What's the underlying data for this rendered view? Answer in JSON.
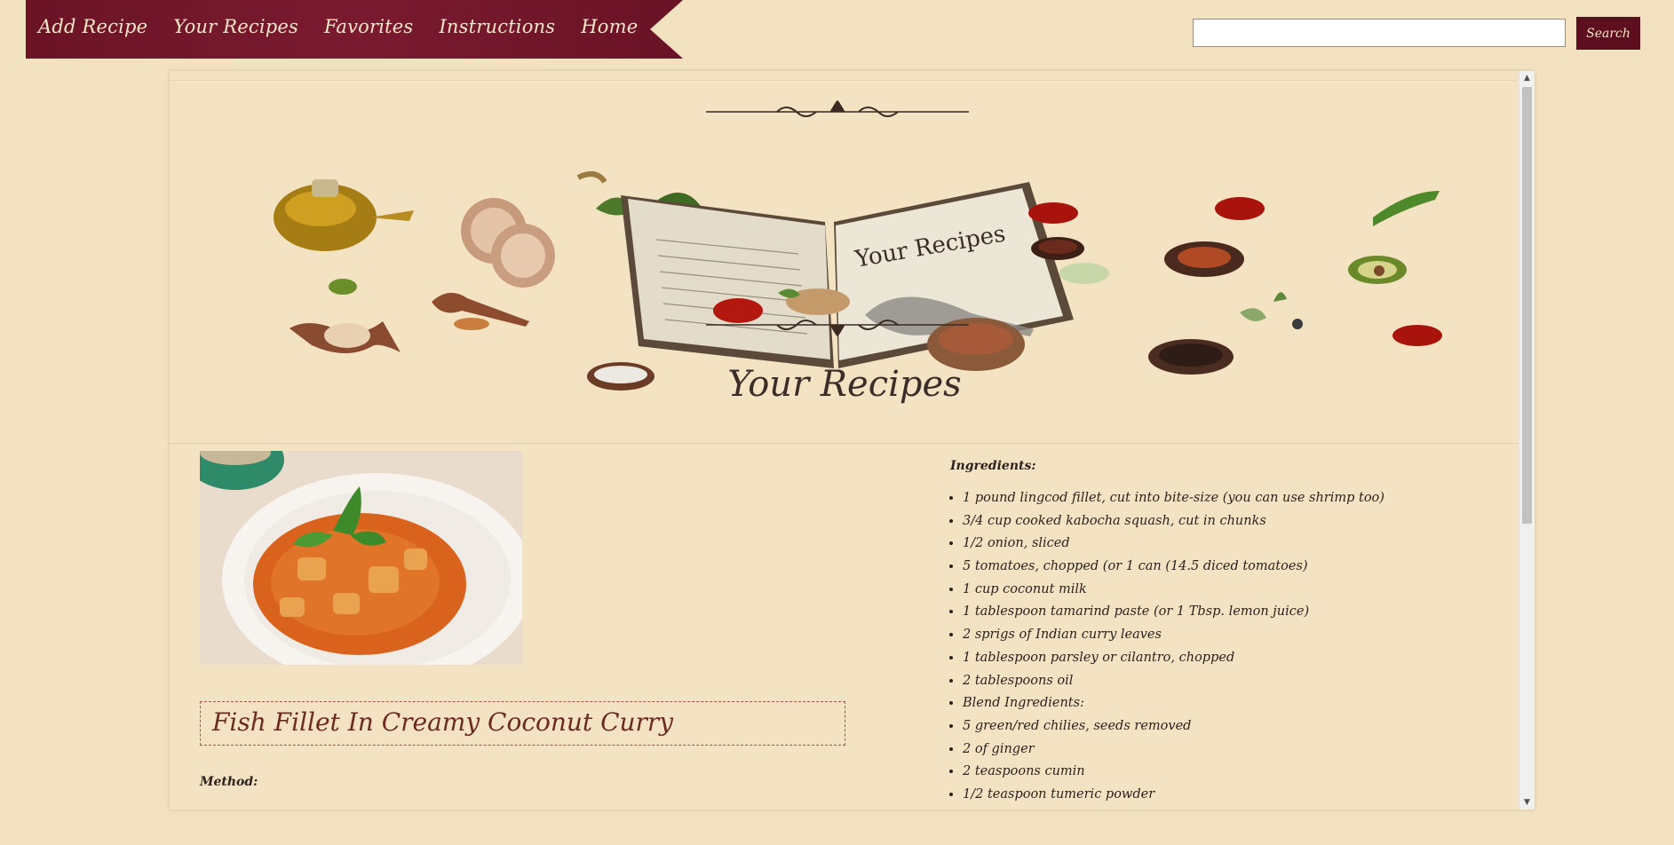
{
  "nav": {
    "items": [
      {
        "label": "Add Recipe"
      },
      {
        "label": "Your Recipes"
      },
      {
        "label": "Favorites"
      },
      {
        "label": "Instructions"
      },
      {
        "label": "Home"
      }
    ]
  },
  "search": {
    "placeholder": "",
    "button_label": "Search"
  },
  "hero": {
    "title": "Your Recipes",
    "book_text": "Your Recipes"
  },
  "recipe": {
    "title": "Fish Fillet In Creamy Coconut Curry",
    "method_label": "Method:",
    "ingredients_label": "Ingredients:",
    "ingredients": [
      "1 pound lingcod fillet, cut into bite-size (you can use shrimp too)",
      "3/4 cup cooked kabocha squash, cut in chunks",
      "1/2 onion, sliced",
      "5 tomatoes, chopped (or 1 can (14.5 diced tomatoes)",
      "1 cup coconut milk",
      "1 tablespoon tamarind paste (or 1 Tbsp. lemon juice)",
      "2 sprigs of Indian curry leaves",
      "1 tablespoon parsley or cilantro, chopped",
      "2 tablespoons oil",
      "Blend Ingredients:",
      "5 green/red chilies, seeds removed",
      "2 of ginger",
      "2 teaspoons cumin",
      "1/2 teaspoon tumeric powder"
    ]
  },
  "colors": {
    "nav_bg": "#6b1426",
    "button_bg": "#5e0f1f",
    "page_bg": "#f3e2c0",
    "title_color": "#6b2a22"
  },
  "scroll": {
    "position_fraction": 0.0
  }
}
